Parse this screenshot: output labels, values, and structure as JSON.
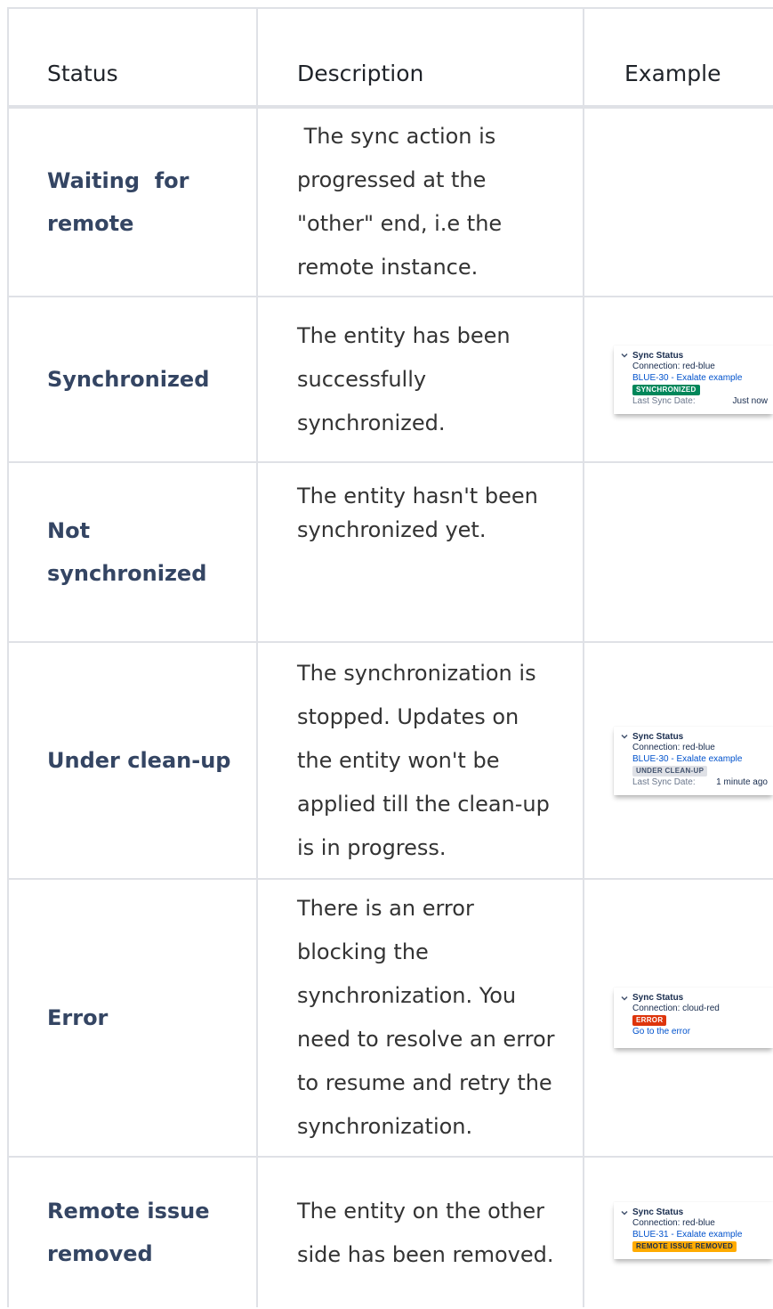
{
  "header": {
    "status": "Status",
    "description": "Description",
    "example": "Example"
  },
  "colors": {
    "border": "#dfe1e6",
    "status_text": "#344563",
    "link": "#0052cc",
    "badge_synchronized": "#00875a",
    "badge_cleanup": "#dfe1e6",
    "badge_error": "#de350b",
    "badge_remote_removed": "#ffab00"
  },
  "rows": [
    {
      "status_lines": [
        "Waiting  for",
        "remote"
      ],
      "desc_lines": [
        " The sync action is",
        "progressed at the",
        "\"other\" end, i.e the",
        "remote instance."
      ]
    },
    {
      "status_lines": [
        "Synchronized"
      ],
      "desc_lines": [
        "The entity has been",
        "successfully",
        "synchronized."
      ],
      "example": {
        "title": "Sync Status",
        "connection": "Connection: red-blue",
        "link": "BLUE-30 - Exalate example",
        "badge": "SYNCHRONIZED",
        "last_sync_label": "Last Sync Date:",
        "last_sync_value": "Just now"
      }
    },
    {
      "status_lines": [
        "Not",
        "synchronized"
      ],
      "desc_lines": [
        "The entity hasn't been",
        "synchronized yet."
      ]
    },
    {
      "status_lines": [
        "Under clean-up"
      ],
      "desc_lines": [
        "The synchronization is",
        "stopped. Updates on",
        "the entity won't be",
        "applied till the clean-up",
        "is in progress."
      ],
      "example": {
        "title": "Sync Status",
        "connection": "Connection: red-blue",
        "link": "BLUE-30 - Exalate example",
        "badge": "UNDER CLEAN-UP",
        "last_sync_label": "Last Sync Date:",
        "last_sync_value": "1 minute ago"
      }
    },
    {
      "status_lines": [
        "Error"
      ],
      "desc_lines": [
        "There is an error",
        "blocking the",
        "synchronization. You",
        "need to resolve an error",
        "to resume and retry the",
        "synchronization."
      ],
      "example": {
        "title": "Sync Status",
        "connection": "Connection: cloud-red",
        "badge": "ERROR",
        "link": "Go to the error"
      }
    },
    {
      "status_lines": [
        "Remote issue",
        "removed"
      ],
      "desc_lines": [
        "The entity on the other",
        "side has been removed."
      ],
      "example": {
        "title": "Sync Status",
        "connection": "Connection: red-blue",
        "link": "BLUE-31 - Exalate example",
        "badge": "REMOTE ISSUE REMOVED"
      }
    }
  ]
}
